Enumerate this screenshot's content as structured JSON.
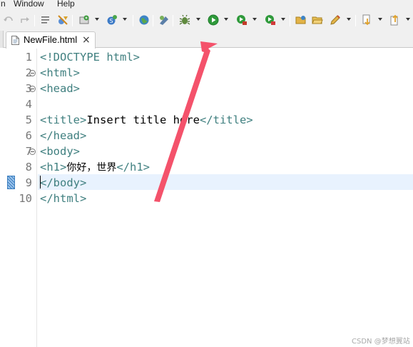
{
  "menubar": {
    "items": [
      {
        "label": "n"
      },
      {
        "label": "Window"
      },
      {
        "label": "Help"
      }
    ]
  },
  "toolbar": {
    "buttons": [
      {
        "icon": "back-gray-icon"
      },
      {
        "icon": "forward-gray-icon"
      },
      {
        "icon": "toggle-mark-occurrences-icon"
      },
      {
        "icon": "skip-breakpoints-icon"
      },
      {
        "icon": "new-server-icon"
      },
      {
        "icon": "new-java-class-icon"
      },
      {
        "icon": "globe-icon"
      },
      {
        "icon": "open-type-icon"
      },
      {
        "icon": "debug-icon"
      },
      {
        "icon": "run-icon"
      },
      {
        "icon": "coverage-icon"
      },
      {
        "icon": "external-tools-icon"
      },
      {
        "icon": "open-folder-icon"
      },
      {
        "icon": "folder-icon"
      },
      {
        "icon": "pencil-icon"
      },
      {
        "icon": "next-annotation-icon"
      },
      {
        "icon": "previous-annotation-icon"
      }
    ]
  },
  "editor": {
    "tab": {
      "label": "NewFile.html",
      "close": "×",
      "icon": "html-file-icon"
    },
    "current_line": 9,
    "lines": [
      {
        "number": "1",
        "segments": [
          {
            "t": "tag",
            "text": "<!DOCTYPE html>"
          }
        ]
      },
      {
        "number": "2",
        "segments": [
          {
            "t": "tag",
            "text": "<html>"
          }
        ],
        "fold": true
      },
      {
        "number": "3",
        "segments": [
          {
            "t": "tag",
            "text": "<head>"
          }
        ],
        "fold": true
      },
      {
        "number": "4",
        "segments": []
      },
      {
        "number": "5",
        "segments": [
          {
            "t": "tag",
            "text": "<title>"
          },
          {
            "t": "txt",
            "text": "Insert title here"
          },
          {
            "t": "tag",
            "text": "</title>"
          }
        ]
      },
      {
        "number": "6",
        "segments": [
          {
            "t": "tag",
            "text": "</head>"
          }
        ]
      },
      {
        "number": "7",
        "segments": [
          {
            "t": "tag",
            "text": "<body>"
          }
        ],
        "fold": true
      },
      {
        "number": "8",
        "segments": [
          {
            "t": "tag",
            "text": "<h1>"
          },
          {
            "t": "cjk",
            "text": "你好，世界"
          },
          {
            "t": "tag",
            "text": "</h1>"
          }
        ]
      },
      {
        "number": "9",
        "segments": [
          {
            "t": "tag",
            "text": "</body>"
          }
        ]
      },
      {
        "number": "10",
        "segments": [
          {
            "t": "tag",
            "text": "</html>"
          }
        ]
      }
    ]
  },
  "colors": {
    "tag": "#3f7f7f",
    "text": "#000000",
    "line_number": "#787878",
    "current_line_highlight": "#e8f2fe",
    "annotation_arrow": "#f4526b"
  },
  "watermark": "CSDN @梦想翼站"
}
